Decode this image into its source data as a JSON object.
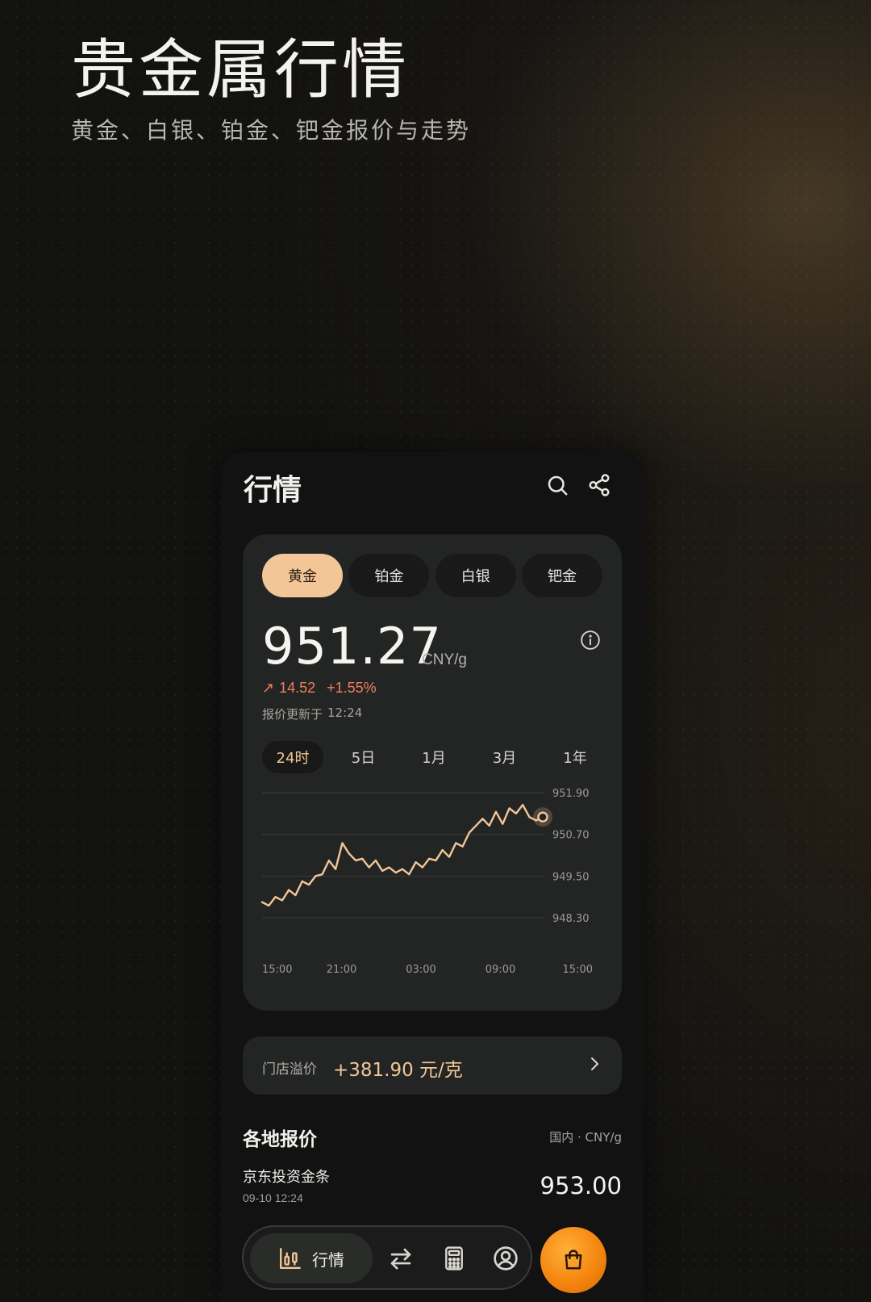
{
  "hero": {
    "title": "贵金属行情",
    "subtitle": "黄金、白银、铂金、钯金报价与走势"
  },
  "header": {
    "title": "行情",
    "icons": [
      "search-icon",
      "share-icon"
    ]
  },
  "metals": [
    "黄金",
    "铂金",
    "白银",
    "钯金"
  ],
  "metal_selected": "黄金",
  "quote": {
    "price": "951.27",
    "unit": "CNY/g",
    "change": "14.52",
    "change_pct": "+1.55%",
    "updated_label": "报价更新于",
    "updated_time": "12:24"
  },
  "ranges": [
    "24时",
    "5日",
    "1月",
    "3月",
    "1年"
  ],
  "range_selected": "24时",
  "chart_data": {
    "type": "line",
    "x_ticks": [
      "15:00",
      "21:00",
      "03:00",
      "09:00",
      "15:00"
    ],
    "y_ticks": [
      951.9,
      950.7,
      949.5,
      948.3
    ],
    "ylim": [
      948.3,
      951.9
    ],
    "grid": true,
    "series": [
      {
        "values": [
          948.75,
          948.65,
          948.9,
          948.8,
          949.1,
          948.95,
          949.35,
          949.25,
          949.5,
          949.55,
          949.95,
          949.7,
          950.45,
          950.15,
          949.95,
          950.0,
          949.75,
          949.95,
          949.65,
          949.75,
          949.6,
          949.7,
          949.55,
          949.9,
          949.75,
          950.0,
          949.95,
          950.25,
          950.05,
          950.45,
          950.35,
          950.75,
          950.95,
          951.15,
          950.95,
          951.35,
          951.0,
          951.45,
          951.3,
          951.55,
          951.2,
          951.1,
          951.2
        ]
      }
    ],
    "last_value": 951.27
  },
  "colors": {
    "accent": "#f2c697",
    "up": "#f07d62",
    "fab": "#f5860f"
  },
  "premium": {
    "label": "门店溢价",
    "value": "+381.90 元/克"
  },
  "regional": {
    "title": "各地报价",
    "meta": "国内 · CNY/g",
    "rows": [
      {
        "name": "京东投资金条",
        "time": "09-10 12:24",
        "price": "953.00"
      }
    ]
  },
  "nav": {
    "active_label": "行情",
    "icons": [
      "chart-icon",
      "exchange-icon",
      "calculator-icon",
      "user-icon"
    ],
    "fab_icon": "shopping-bag-icon"
  }
}
